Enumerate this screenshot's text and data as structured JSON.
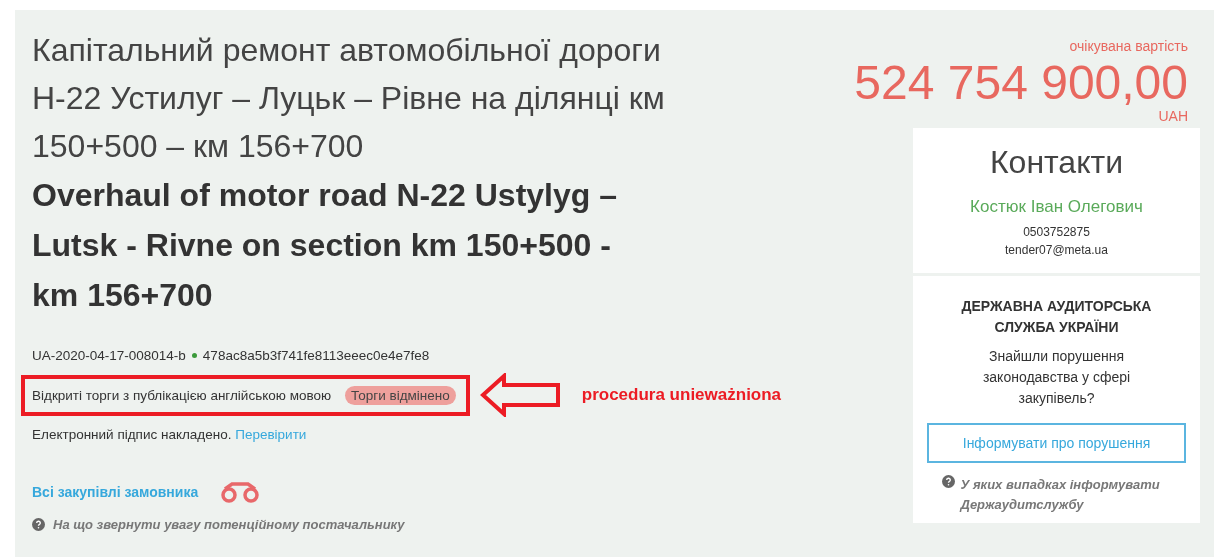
{
  "title_uk": "Капітальний ремонт автомобільної дороги Н-22 Устилуг – Луцьк – Рівне на ділянці км 150+500 – км 156+700",
  "title_en": "Overhaul of motor road N-22 Ustylyg – Lutsk - Rivne on section km 150+500 - km 156+700",
  "tender_id": "UA-2020-04-17-008014-b",
  "hash": "478ac8a5b3f741fe8113eeec0e4e7fe8",
  "procedure": "Відкриті торги з публікацією англійською мовою",
  "status_badge": "Торги відмінено",
  "annotation": "procedura unieważniona",
  "signature": {
    "text": "Електронний підпис накладено.",
    "link": "Перевірити"
  },
  "all_purchases_link": "Всі закупівлі замовника",
  "hint": "На що звернути увагу потенційному постачальнику",
  "price": {
    "label": "очікувана вартість",
    "amount": "524 754 900,00",
    "currency": "UAH"
  },
  "contacts": {
    "heading": "Контакти",
    "name": "Костюк Іван Олегович",
    "phone": "0503752875",
    "email": "tender07@meta.ua"
  },
  "audit": {
    "heading": "ДЕРЖАВНА АУДИТОРСЬКА СЛУЖБА УКРАЇНИ",
    "question": "Знайшли порушення законодавства у сфері закупівель?",
    "button": "Інформувати про порушення",
    "hint": "У яких випадках інформувати Держаудитслужбу"
  }
}
